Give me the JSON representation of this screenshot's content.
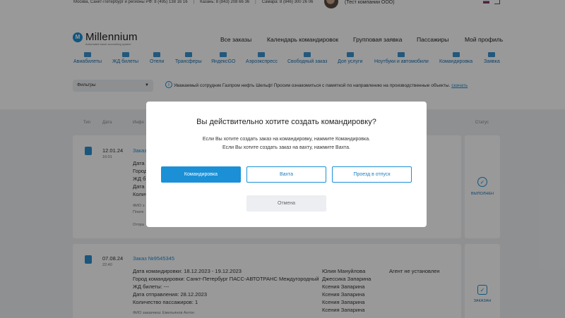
{
  "topbar": {
    "phone_main": "Москва, Санкт-Петербург и регионы РФ: 8 (495) 138 16 16",
    "phone_kazan": "Казань: 8 (843) 208 66 36",
    "phone_samara": "Самара: 8 (846) 300 26 06",
    "company": "(Тест компании ООО)"
  },
  "logo": {
    "name": "Millennium",
    "tagline": "Automated travel accounting system",
    "mark": "M"
  },
  "mainnav": [
    "Все заказы",
    "Календарь командировок",
    "Групповая заявка",
    "Пассажиры",
    "Мой профиль"
  ],
  "categories": [
    "Авиабилеты",
    "ЖД билеты",
    "Отели",
    "Трансферы",
    "ЯндексGO",
    "Аэроэкспресс",
    "Свободный заказ",
    "Доп услуги",
    "Ноутбуки и автомобили",
    "Командировка",
    "Заявка"
  ],
  "filters": {
    "label": "Фильтры"
  },
  "notice": {
    "text": "Уважаемый сотрудник Газпром нефть Шельф! Просим ознакомиться с памяткой по направлению на производственные объекты.",
    "link": "скачать"
  },
  "columns": {
    "type": "Тип",
    "date": "Дата",
    "info": "Инфо",
    "status": "Статус"
  },
  "orders": [
    {
      "date": "12.01.24",
      "time": "16:01",
      "lines": [
        "Дата к",
        "Город",
        "ЖД б",
        "Дата о",
        "Колич"
      ],
      "contact": "ФИО з",
      "payer": "Плате",
      "sent": "Отпра",
      "status": "ВЫПОЛНЕН",
      "order_label": "Заказ"
    },
    {
      "date": "07.08.24",
      "time": "22:40",
      "order_label": "Заказ №9545345",
      "lines": [
        "Дата командировки: 18.12.2023 - 19.12.2023",
        "Город командировки: Санкт-Петербург ПАСС-АВТОТРАНС Междугородный",
        "ЖД билеты: ---",
        "Дата отправления: 28.12.2023",
        "Количество пассажиров: 1"
      ],
      "passengers": [
        "Юлия Мануйлова",
        "Джессика Запарина",
        "Ксения Запарина",
        "Ксения Запарина",
        "Ксения Запарина",
        "Ксения Запарина"
      ],
      "agent": "Агент не установлен",
      "contact": "ФИО заказчика: Емельянов Антон",
      "status": "ЗАКАЗАН"
    }
  ],
  "modal": {
    "title": "Вы действительно хотите создать командировку?",
    "line1": "Если Вы хотите создать заказ на командировку, нажмите Командировка.",
    "line2": "Если Вы хотите создать заказ на вахту, нажмите Вахта.",
    "btn_trip": "Командировка",
    "btn_shift": "Вахта",
    "btn_vacation": "Проезд в отпуск",
    "btn_cancel": "Отмена"
  }
}
